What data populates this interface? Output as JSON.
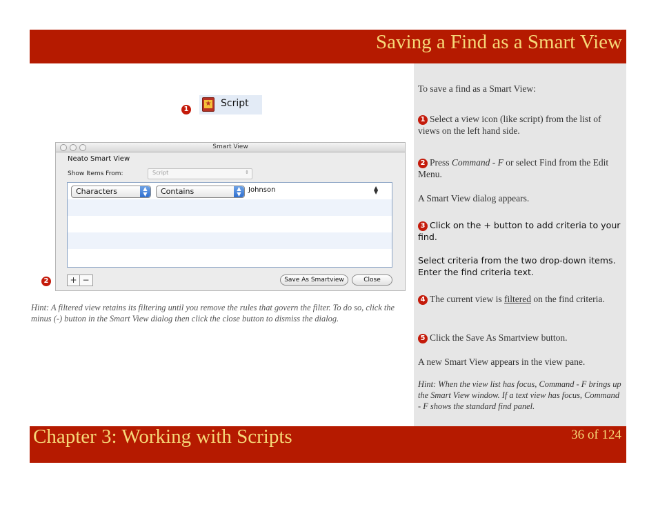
{
  "slide": {
    "title": "Saving a Find as a Smart View",
    "chapter": "Chapter 3: Working with Scripts",
    "page": "36 of 124"
  },
  "callouts": {
    "c1": "1",
    "c2": "2"
  },
  "script_item": {
    "label": "Script",
    "icon": "script-book-icon"
  },
  "dialog": {
    "window_title": "Smart View",
    "name": "Neato Smart View",
    "show_items_label": "Show Items From:",
    "show_items_value": "Script",
    "rule": {
      "field": "Characters",
      "operator": "Contains",
      "value": "Johnson"
    },
    "plus": "+",
    "minus": "−",
    "save_button": "Save As Smartview",
    "close_button": "Close"
  },
  "left_hint": "Hint: A filtered view retains its filtering until you remove the rules that govern the filter. To do so, click the minus (-) button in the Smart View dialog then click the close button to dismiss the dialog.",
  "instructions": {
    "intro": "To save a find as a Smart View:",
    "s1_num": "1",
    "s1": "Select a view icon (like script) from the list of views on the left hand side.",
    "s2_num": "2",
    "s2_a": "Press ",
    "s2_cmd": "Command - F",
    "s2_b": " or select Find from the Edit Menu.",
    "appears": "A Smart View dialog appears.",
    "s3_num": "3",
    "s3": "Click on the + button to add criteria to your find.",
    "select_criteria": "Select criteria from the two drop-down items. Enter the find criteria text.",
    "s4_num": "4",
    "s4_a": "The current view is ",
    "s4_link": "filtered",
    "s4_b": " on the find criteria.",
    "s5_num": "5",
    "s5": "Click the Save As Smartview button.",
    "new_view": "A new Smart View appears in the view pane.",
    "hint": "Hint: When the view list has focus, Command - F brings up the Smart View window. If a text view has focus, Command - F shows the standard find panel."
  },
  "colors": {
    "header_red": "#b51a00",
    "title_yellow": "#f6d878",
    "panel_gray": "#e6e6e6",
    "callout_red": "#c41a0a"
  }
}
